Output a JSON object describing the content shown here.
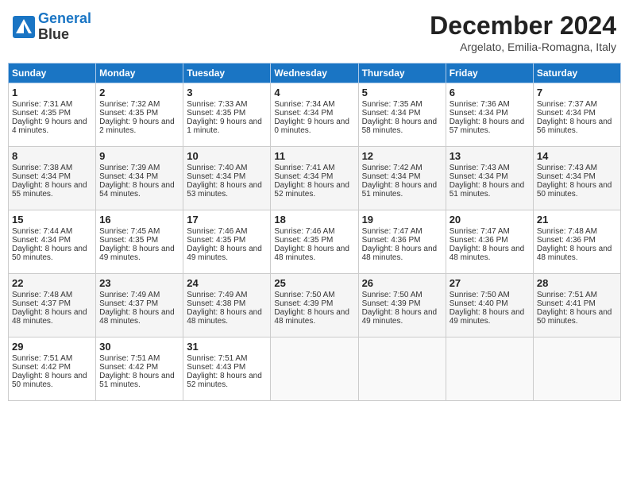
{
  "header": {
    "logo_line1": "General",
    "logo_line2": "Blue",
    "month_title": "December 2024",
    "location": "Argelato, Emilia-Romagna, Italy"
  },
  "days_of_week": [
    "Sunday",
    "Monday",
    "Tuesday",
    "Wednesday",
    "Thursday",
    "Friday",
    "Saturday"
  ],
  "weeks": [
    [
      {
        "day": 1,
        "sunrise": "7:31 AM",
        "sunset": "4:35 PM",
        "daylight": "9 hours and 4 minutes."
      },
      {
        "day": 2,
        "sunrise": "7:32 AM",
        "sunset": "4:35 PM",
        "daylight": "9 hours and 2 minutes."
      },
      {
        "day": 3,
        "sunrise": "7:33 AM",
        "sunset": "4:35 PM",
        "daylight": "9 hours and 1 minute."
      },
      {
        "day": 4,
        "sunrise": "7:34 AM",
        "sunset": "4:34 PM",
        "daylight": "9 hours and 0 minutes."
      },
      {
        "day": 5,
        "sunrise": "7:35 AM",
        "sunset": "4:34 PM",
        "daylight": "8 hours and 58 minutes."
      },
      {
        "day": 6,
        "sunrise": "7:36 AM",
        "sunset": "4:34 PM",
        "daylight": "8 hours and 57 minutes."
      },
      {
        "day": 7,
        "sunrise": "7:37 AM",
        "sunset": "4:34 PM",
        "daylight": "8 hours and 56 minutes."
      }
    ],
    [
      {
        "day": 8,
        "sunrise": "7:38 AM",
        "sunset": "4:34 PM",
        "daylight": "8 hours and 55 minutes."
      },
      {
        "day": 9,
        "sunrise": "7:39 AM",
        "sunset": "4:34 PM",
        "daylight": "8 hours and 54 minutes."
      },
      {
        "day": 10,
        "sunrise": "7:40 AM",
        "sunset": "4:34 PM",
        "daylight": "8 hours and 53 minutes."
      },
      {
        "day": 11,
        "sunrise": "7:41 AM",
        "sunset": "4:34 PM",
        "daylight": "8 hours and 52 minutes."
      },
      {
        "day": 12,
        "sunrise": "7:42 AM",
        "sunset": "4:34 PM",
        "daylight": "8 hours and 51 minutes."
      },
      {
        "day": 13,
        "sunrise": "7:43 AM",
        "sunset": "4:34 PM",
        "daylight": "8 hours and 51 minutes."
      },
      {
        "day": 14,
        "sunrise": "7:43 AM",
        "sunset": "4:34 PM",
        "daylight": "8 hours and 50 minutes."
      }
    ],
    [
      {
        "day": 15,
        "sunrise": "7:44 AM",
        "sunset": "4:34 PM",
        "daylight": "8 hours and 50 minutes."
      },
      {
        "day": 16,
        "sunrise": "7:45 AM",
        "sunset": "4:35 PM",
        "daylight": "8 hours and 49 minutes."
      },
      {
        "day": 17,
        "sunrise": "7:46 AM",
        "sunset": "4:35 PM",
        "daylight": "8 hours and 49 minutes."
      },
      {
        "day": 18,
        "sunrise": "7:46 AM",
        "sunset": "4:35 PM",
        "daylight": "8 hours and 48 minutes."
      },
      {
        "day": 19,
        "sunrise": "7:47 AM",
        "sunset": "4:36 PM",
        "daylight": "8 hours and 48 minutes."
      },
      {
        "day": 20,
        "sunrise": "7:47 AM",
        "sunset": "4:36 PM",
        "daylight": "8 hours and 48 minutes."
      },
      {
        "day": 21,
        "sunrise": "7:48 AM",
        "sunset": "4:36 PM",
        "daylight": "8 hours and 48 minutes."
      }
    ],
    [
      {
        "day": 22,
        "sunrise": "7:48 AM",
        "sunset": "4:37 PM",
        "daylight": "8 hours and 48 minutes."
      },
      {
        "day": 23,
        "sunrise": "7:49 AM",
        "sunset": "4:37 PM",
        "daylight": "8 hours and 48 minutes."
      },
      {
        "day": 24,
        "sunrise": "7:49 AM",
        "sunset": "4:38 PM",
        "daylight": "8 hours and 48 minutes."
      },
      {
        "day": 25,
        "sunrise": "7:50 AM",
        "sunset": "4:39 PM",
        "daylight": "8 hours and 48 minutes."
      },
      {
        "day": 26,
        "sunrise": "7:50 AM",
        "sunset": "4:39 PM",
        "daylight": "8 hours and 49 minutes."
      },
      {
        "day": 27,
        "sunrise": "7:50 AM",
        "sunset": "4:40 PM",
        "daylight": "8 hours and 49 minutes."
      },
      {
        "day": 28,
        "sunrise": "7:51 AM",
        "sunset": "4:41 PM",
        "daylight": "8 hours and 50 minutes."
      }
    ],
    [
      {
        "day": 29,
        "sunrise": "7:51 AM",
        "sunset": "4:42 PM",
        "daylight": "8 hours and 50 minutes."
      },
      {
        "day": 30,
        "sunrise": "7:51 AM",
        "sunset": "4:42 PM",
        "daylight": "8 hours and 51 minutes."
      },
      {
        "day": 31,
        "sunrise": "7:51 AM",
        "sunset": "4:43 PM",
        "daylight": "8 hours and 52 minutes."
      },
      null,
      null,
      null,
      null
    ]
  ]
}
